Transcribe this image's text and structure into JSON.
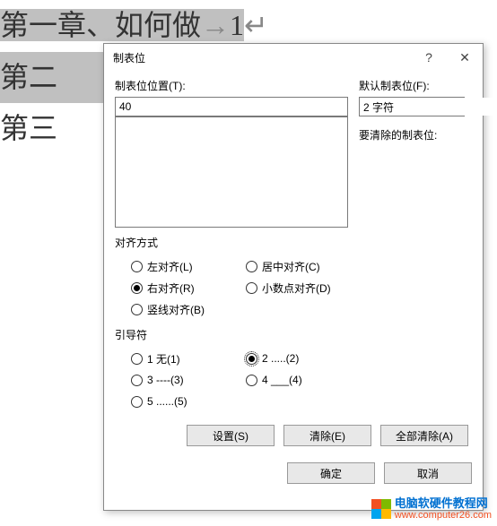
{
  "document": {
    "line1": "第一章、如何做",
    "line1_tab": "→",
    "line1_num": "1",
    "line1_mark": "↵",
    "line2": "第二",
    "line3": "第三"
  },
  "dialog": {
    "title": "制表位",
    "help": "?",
    "close": "✕",
    "tab_stop_position_label": "制表位位置(T):",
    "tab_stop_position_value": "40",
    "default_tab_label": "默认制表位(F):",
    "default_tab_value": "2 字符",
    "clear_label": "要清除的制表位:",
    "alignment_label": "对齐方式",
    "alignment": {
      "left": "左对齐(L)",
      "center": "居中对齐(C)",
      "right": "右对齐(R)",
      "decimal": "小数点对齐(D)",
      "bar": "竖线对齐(B)",
      "selected": "right"
    },
    "leader_label": "引导符",
    "leader": {
      "opt1": "1 无(1)",
      "opt2": "2 .....(2)",
      "opt3": "3 ----(3)",
      "opt4": "4 ___(4)",
      "opt5": "5 ......(5)",
      "selected": "2"
    },
    "buttons": {
      "set": "设置(S)",
      "clear": "清除(E)",
      "clear_all": "全部清除(A)",
      "ok": "确定",
      "cancel": "取消"
    }
  },
  "watermark": {
    "text1": "电脑软硬件教程网",
    "text2": "www.computer26.com"
  }
}
